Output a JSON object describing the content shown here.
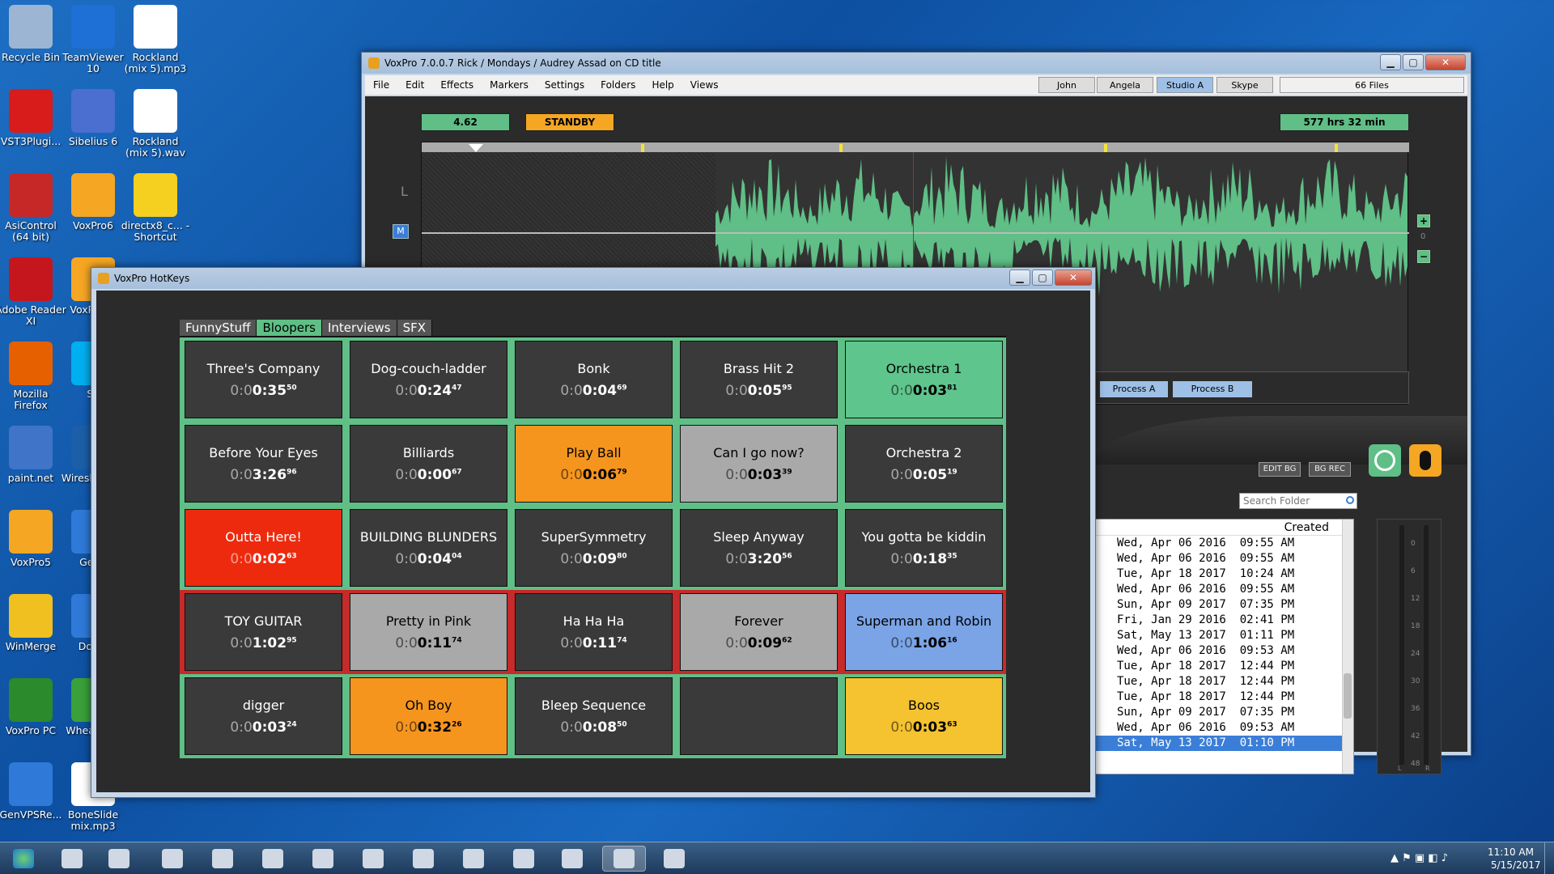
{
  "desktop_icons": [
    {
      "label": "Recycle Bin",
      "icon": "recycle-bin-icon",
      "col": 0,
      "row": 0
    },
    {
      "label": "TeamViewer 10",
      "icon": "teamviewer-icon",
      "col": 1,
      "row": 0
    },
    {
      "label": "Rockland (mix 5).mp3",
      "icon": "mp3-file-icon",
      "col": 2,
      "row": 0
    },
    {
      "label": "VST3Plugi...",
      "icon": "vst-icon",
      "col": 0,
      "row": 1
    },
    {
      "label": "Sibelius 6",
      "icon": "sibelius-icon",
      "col": 1,
      "row": 1
    },
    {
      "label": "Rockland (mix 5).wav",
      "icon": "wav-file-icon",
      "col": 2,
      "row": 1
    },
    {
      "label": "AsiControl (64 bit)",
      "icon": "asicontrol-icon",
      "col": 0,
      "row": 2
    },
    {
      "label": "VoxPro6",
      "icon": "voxpro-icon",
      "col": 1,
      "row": 2
    },
    {
      "label": "directx8_c... - Shortcut",
      "icon": "help-shortcut-icon",
      "col": 2,
      "row": 2
    },
    {
      "label": "Adobe Reader XI",
      "icon": "adobe-reader-icon",
      "col": 0,
      "row": 3
    },
    {
      "label": "VoxP Sho",
      "icon": "voxpro-icon",
      "col": 1,
      "row": 3
    },
    {
      "label": "Mozilla Firefox",
      "icon": "firefox-icon",
      "col": 0,
      "row": 4
    },
    {
      "label": "Sk",
      "icon": "skype-icon",
      "col": 1,
      "row": 4
    },
    {
      "label": "paint.net",
      "icon": "paintnet-icon",
      "col": 0,
      "row": 5
    },
    {
      "label": "Wiresh - Sho",
      "icon": "wireshark-icon",
      "col": 1,
      "row": 5
    },
    {
      "label": "VoxPro5",
      "icon": "voxpro-icon",
      "col": 0,
      "row": 6
    },
    {
      "label": "GenV",
      "icon": "genvps-icon",
      "col": 1,
      "row": 6
    },
    {
      "label": "WinMerge",
      "icon": "winmerge-icon",
      "col": 0,
      "row": 7
    },
    {
      "label": "Dongl",
      "icon": "dongle-icon",
      "col": 1,
      "row": 7
    },
    {
      "label": "VoxPro PC",
      "icon": "voxpro-pc-icon",
      "col": 0,
      "row": 8
    },
    {
      "label": "Whea Navi",
      "icon": "wheat-icon",
      "col": 1,
      "row": 8
    },
    {
      "label": "GenVPSRe...",
      "icon": "genvps-icon",
      "col": 0,
      "row": 9
    },
    {
      "label": "BoneSlide mix.mp3",
      "icon": "mp3-file-icon",
      "col": 1,
      "row": 9
    }
  ],
  "voxpro": {
    "title": "VoxPro 7.0.0.7   Rick / Mondays / Audrey Assad on CD title",
    "menu": [
      "File",
      "Edit",
      "Effects",
      "Markers",
      "Settings",
      "Folders",
      "Help",
      "Views"
    ],
    "users": [
      {
        "label": "John",
        "selected": false
      },
      {
        "label": "Angela",
        "selected": false
      },
      {
        "label": "Studio A",
        "selected": true
      },
      {
        "label": "Skype",
        "selected": false
      }
    ],
    "file_count": "66 Files",
    "position": "4.62",
    "state": "STANDBY",
    "remaining": "577 hrs  32 min",
    "channel_label": "L",
    "mono_button": "M",
    "zoom_value": "0",
    "process_a": "Process A",
    "process_b": "Process B",
    "edit_bg": "EDIT BG",
    "bg_rec": "BG REC",
    "search_placeholder": "Search Folder",
    "col_created": "Created",
    "dates": [
      "Wed, Apr 06 2016  09:55 AM",
      "Wed, Apr 06 2016  09:55 AM",
      "Tue, Apr 18 2017  10:24 AM",
      "Wed, Apr 06 2016  09:55 AM",
      "Sun, Apr 09 2017  07:35 PM",
      "Fri, Jan 29 2016  02:41 PM",
      "Sat, May 13 2017  01:11 PM",
      "Wed, Apr 06 2016  09:53 AM",
      "Tue, Apr 18 2017  12:44 PM",
      "Tue, Apr 18 2017  12:44 PM",
      "Tue, Apr 18 2017  12:44 PM",
      "Sun, Apr 09 2017  07:35 PM",
      "Wed, Apr 06 2016  09:53 AM",
      "Sat, May 13 2017  01:10 PM"
    ],
    "selected_date_index": 13,
    "meter_ticks": [
      "0",
      "6",
      "12",
      "18",
      "24",
      "30",
      "36",
      "42",
      "48"
    ],
    "meter_l": "L",
    "meter_r": "R"
  },
  "hotkeys": {
    "title": "VoxPro HotKeys",
    "tabs": [
      {
        "label": "FunnyStuff",
        "selected": false
      },
      {
        "label": "Bloopers",
        "selected": true
      },
      {
        "label": "Interviews",
        "selected": false
      },
      {
        "label": "SFX",
        "selected": false
      }
    ],
    "cells": [
      {
        "name": "Three's Company",
        "dim": "0:0",
        "time": "0:35",
        "frac": "50",
        "color": "#3a3a3a",
        "text": "#ffffff"
      },
      {
        "name": "Dog-couch-ladder",
        "dim": "0:0",
        "time": "0:24",
        "frac": "47",
        "color": "#3a3a3a",
        "text": "#ffffff"
      },
      {
        "name": "Bonk",
        "dim": "0:0",
        "time": "0:04",
        "frac": "69",
        "color": "#3a3a3a",
        "text": "#ffffff"
      },
      {
        "name": "Brass Hit 2",
        "dim": "0:0",
        "time": "0:05",
        "frac": "95",
        "color": "#3a3a3a",
        "text": "#ffffff"
      },
      {
        "name": "Orchestra 1",
        "dim": "0:0",
        "time": "0:03",
        "frac": "81",
        "color": "#5ec58c",
        "text": "#000000"
      },
      {
        "name": "Before Your Eyes",
        "dim": "0:0",
        "time": "3:26",
        "frac": "96",
        "color": "#3a3a3a",
        "text": "#ffffff"
      },
      {
        "name": "Billiards",
        "dim": "0:0",
        "time": "0:00",
        "frac": "67",
        "color": "#3a3a3a",
        "text": "#ffffff"
      },
      {
        "name": "Play Ball",
        "dim": "0:0",
        "time": "0:06",
        "frac": "79",
        "color": "#f5951e",
        "text": "#000000"
      },
      {
        "name": "Can I go now?",
        "dim": "0:0",
        "time": "0:03",
        "frac": "39",
        "color": "#a9a9a9",
        "text": "#000000"
      },
      {
        "name": "Orchestra 2",
        "dim": "0:0",
        "time": "0:05",
        "frac": "19",
        "color": "#3a3a3a",
        "text": "#ffffff"
      },
      {
        "name": "Outta Here!",
        "dim": "0:0",
        "time": "0:02",
        "frac": "63",
        "color": "#ee2a0e",
        "text": "#ffffff"
      },
      {
        "name": "BUILDING BLUNDERS",
        "dim": "0:0",
        "time": "0:04",
        "frac": "04",
        "color": "#3a3a3a",
        "text": "#ffffff"
      },
      {
        "name": "SuperSymmetry",
        "dim": "0:0",
        "time": "0:09",
        "frac": "80",
        "color": "#3a3a3a",
        "text": "#ffffff"
      },
      {
        "name": "Sleep Anyway",
        "dim": "0:0",
        "time": "3:20",
        "frac": "56",
        "color": "#3a3a3a",
        "text": "#ffffff"
      },
      {
        "name": "You gotta be kiddin",
        "dim": "0:0",
        "time": "0:18",
        "frac": "35",
        "color": "#3a3a3a",
        "text": "#ffffff"
      },
      {
        "name": "TOY GUITAR",
        "dim": "0:0",
        "time": "1:02",
        "frac": "95",
        "color": "#3a3a3a",
        "text": "#ffffff"
      },
      {
        "name": "Pretty in Pink",
        "dim": "0:0",
        "time": "0:11",
        "frac": "74",
        "color": "#a9a9a9",
        "text": "#000000"
      },
      {
        "name": "Ha Ha Ha",
        "dim": "0:0",
        "time": "0:11",
        "frac": "74",
        "color": "#3a3a3a",
        "text": "#ffffff"
      },
      {
        "name": "Forever",
        "dim": "0:0",
        "time": "0:09",
        "frac": "62",
        "color": "#a9a9a9",
        "text": "#000000"
      },
      {
        "name": "Superman and Robin",
        "dim": "0:0",
        "time": "1:06",
        "frac": "16",
        "color": "#7aa4e6",
        "text": "#000000"
      },
      {
        "name": "digger",
        "dim": "0:0",
        "time": "0:03",
        "frac": "24",
        "color": "#3a3a3a",
        "text": "#ffffff"
      },
      {
        "name": "Oh Boy",
        "dim": "0:0",
        "time": "0:32",
        "frac": "26",
        "color": "#f5951e",
        "text": "#000000"
      },
      {
        "name": "Bleep Sequence",
        "dim": "0:0",
        "time": "0:08",
        "frac": "50",
        "color": "#3a3a3a",
        "text": "#ffffff"
      },
      {
        "name": "",
        "dim": "",
        "time": "",
        "frac": "",
        "color": "#3a3a3a",
        "text": "#ffffff"
      },
      {
        "name": "Boos",
        "dim": "0:0",
        "time": "0:03",
        "frac": "63",
        "color": "#f5c230",
        "text": "#000000"
      }
    ],
    "row_border_colors": [
      "#5fbf86",
      "#5fbf86",
      "#5fbf86",
      "#c62a2a",
      "#5fbf86"
    ]
  },
  "taskbar": {
    "time": "11:10 AM",
    "date": "5/15/2017",
    "buttons": [
      "start-orb-icon",
      "ie-icon",
      "explorer-icon",
      "media-player-icon",
      "genvps-icon",
      "calculator-icon",
      "window-icon",
      "network-icon",
      "cmd-icon",
      "remote-icon",
      "monitor-icon",
      "excel-icon",
      "voxpro-icon",
      "screenshot-icon"
    ],
    "active_index": 12
  }
}
